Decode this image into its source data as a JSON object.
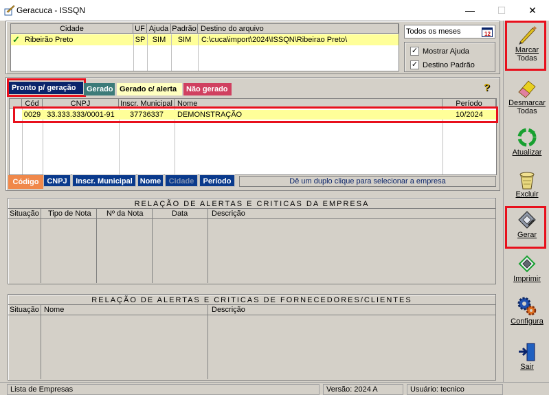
{
  "window": {
    "title": "Geracuca - ISSQN",
    "minimize": "—",
    "maximize": "☐",
    "close": "✕"
  },
  "top_grid": {
    "headers": [
      "Cidade",
      "UF",
      "Ajuda",
      "Padrão",
      "Destino do arquivo"
    ],
    "row": {
      "check": "✓",
      "cidade": "Ribeirão Preto",
      "uf": "SP",
      "ajuda": "SIM",
      "padrao": "SIM",
      "destino": "C:\\cuca\\import\\2024\\ISSQN\\Ribeirao Preto\\"
    }
  },
  "options": {
    "months_select": "Todos os meses",
    "mostrar_ajuda": "Mostrar Ajuda",
    "destino_padrao": "Destino Padrão"
  },
  "tabs": {
    "pronto": "Pronto p/ geração",
    "gerado": "Gerado",
    "gerado_alerta": "Gerado c/ alerta",
    "nao_gerado": "Não gerado",
    "help": "?"
  },
  "company_grid": {
    "headers": [
      "Cód",
      "CNPJ",
      "Inscr. Municipal",
      "Nome",
      "Período"
    ],
    "row": {
      "cod": "0029",
      "cnpj": "33.333.333/0001-91",
      "inscr": "37736337",
      "nome": "DEMONSTRAÇÃO",
      "periodo": "10/2024"
    }
  },
  "sort_buttons": {
    "codigo": "Código",
    "cnpj": "CNPJ",
    "inscr": "Inscr. Municipal",
    "nome": "Nome",
    "cidade": "Cidade",
    "periodo": "Período",
    "hint": "Dê um duplo clique para selecionar a empresa"
  },
  "alerts_empresa": {
    "title": "RELAÇÃO DE ALERTAS E CRITICAS DA EMPRESA",
    "headers": [
      "Situação",
      "Tipo de Nota",
      "Nº da Nota",
      "Data",
      "Descrição"
    ]
  },
  "alerts_fornecedores": {
    "title": "RELAÇÃO DE ALERTAS E CRITICAS DE FORNECEDORES/CLIENTES",
    "headers": [
      "Situação",
      "Nome",
      "Descrição"
    ]
  },
  "sidebar": {
    "marcar": [
      "Marcar",
      "Todas"
    ],
    "desmarcar": [
      "Desmarcar",
      "Todas"
    ],
    "atualizar": "Atualizar",
    "excluir": "Excluir",
    "gerar": "Gerar",
    "imprimir": "Imprimir",
    "configura": "Configura",
    "sair": "Sair"
  },
  "status": {
    "left": "Lista de Empresas",
    "versao": "Versão: 2024 A",
    "usuario": "Usuário: tecnico"
  },
  "colors": {
    "highlight_row": "#ffff99",
    "tab_blue": "#0a246a",
    "tab_green": "#3c7b79",
    "tab_yellow": "#ffffc0",
    "tab_red": "#d04060",
    "sort_orange": "#f0884a",
    "sort_blue": "#0a3a8c",
    "alert_red": "#e8101c"
  }
}
